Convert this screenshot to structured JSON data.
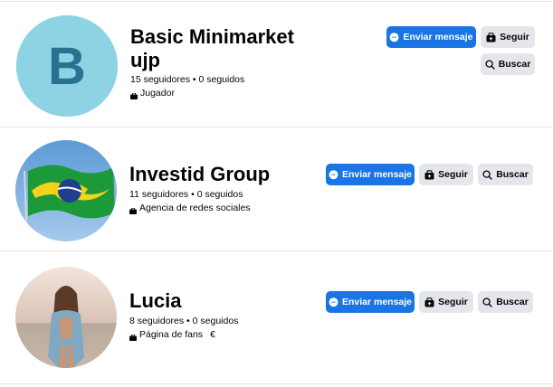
{
  "results": [
    {
      "name_line1": "Basic Minimarket",
      "name_line2": "ujp",
      "avatar_letter": "B",
      "stats": "15 seguidores • 0 seguidos",
      "category": "Jugador",
      "send_message_label": "Enviar mensaje",
      "follow_label": "Seguir",
      "search_label": "Buscar"
    },
    {
      "name_line1": "Investid Group",
      "stats": "11 seguidores • 0 seguidos",
      "category": "Agencia de redes sociales",
      "send_message_label": "Enviar mensaje",
      "follow_label": "Seguir",
      "search_label": "Buscar"
    },
    {
      "name_line1": "Lucia",
      "stats": "8 seguidores • 0 seguidos",
      "category": "Página de fans",
      "category_extra": "€",
      "send_message_label": "Enviar mensaje",
      "follow_label": "Seguir",
      "search_label": "Buscar"
    }
  ],
  "colors": {
    "primary": "#1b74e4",
    "secondary": "#e4e6eb",
    "avatar_b_bg": "#8dd3e3",
    "avatar_b_letter": "#27728f"
  },
  "icons": {
    "messenger": "messenger-icon",
    "follow": "follow-icon",
    "search": "search-icon",
    "category": "briefcase-icon"
  }
}
